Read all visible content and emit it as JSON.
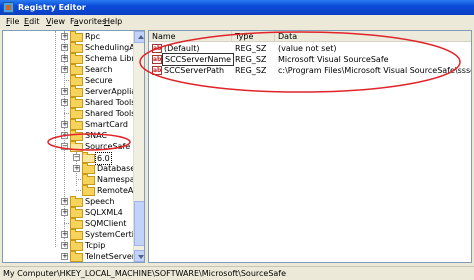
{
  "window": {
    "title": "Registry Editor"
  },
  "menu": [
    {
      "acc": "F",
      "rest": "ile"
    },
    {
      "acc": "E",
      "rest": "dit"
    },
    {
      "acc": "V",
      "rest": "iew"
    },
    {
      "acc": "",
      "pre": "F",
      "acc2": "a",
      "rest": "vorites"
    },
    {
      "acc": "H",
      "rest": "elp"
    }
  ],
  "tree": [
    {
      "label": "Rpc"
    },
    {
      "label": "SchedulingAgent"
    },
    {
      "label": "Schema Library"
    },
    {
      "label": "Search"
    },
    {
      "label": "Secure"
    },
    {
      "label": "ServerAppliance"
    },
    {
      "label": "Shared Tools"
    },
    {
      "label": "Shared Tools Loc"
    },
    {
      "label": "SmartCard"
    },
    {
      "label": "SNAC"
    },
    {
      "label": "SourceSafe"
    },
    {
      "label": "6.0"
    },
    {
      "label": "Databases"
    },
    {
      "label": "Namespace"
    },
    {
      "label": "RemoteAcce"
    },
    {
      "label": "Speech"
    },
    {
      "label": "SQLXML4"
    },
    {
      "label": "SQMClient"
    },
    {
      "label": "SystemCertificat"
    },
    {
      "label": "Tcpip"
    },
    {
      "label": "TelnetServer"
    }
  ],
  "columns": {
    "name": "Name",
    "type": "Type",
    "data": "Data"
  },
  "values": [
    {
      "name": "(Default)",
      "type": "REG_SZ",
      "data": "(value not set)"
    },
    {
      "name": "SCCServerName",
      "type": "REG_SZ",
      "data": "Microsoft Visual SourceSafe"
    },
    {
      "name": "SCCServerPath",
      "type": "REG_SZ",
      "data": "c:\\Program Files\\Microsoft Visual SourceSafe\\ssscc.dll"
    }
  ],
  "value_icon_text": "ab",
  "status": "My Computer\\HKEY_LOCAL_MACHINE\\SOFTWARE\\Microsoft\\SourceSafe",
  "colors": {
    "annotation": "#e0242a",
    "titlebar": "#0a4ad8"
  }
}
